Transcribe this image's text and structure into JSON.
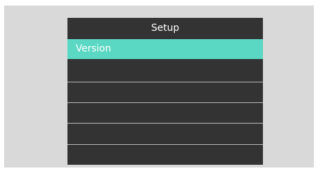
{
  "setup_menu": {
    "title": "Setup",
    "selected_color": "#5bd8c4",
    "items": [
      {
        "label": "Version",
        "selected": true
      },
      {
        "label": "",
        "selected": false
      },
      {
        "label": "",
        "selected": false
      },
      {
        "label": "",
        "selected": false
      },
      {
        "label": "",
        "selected": false
      },
      {
        "label": "",
        "selected": false
      }
    ]
  }
}
